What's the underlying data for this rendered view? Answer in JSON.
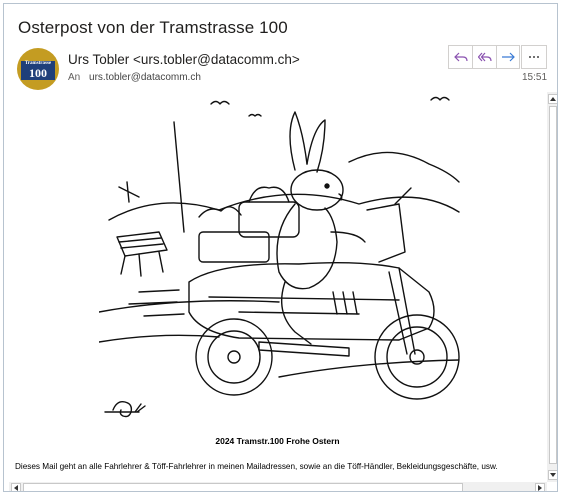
{
  "email": {
    "subject": "Osterpost von der Tramstrasse 100",
    "sender": "Urs Tobler <urs.tobler@datacomm.ch>",
    "to_label": "An",
    "to_address": "urs.tobler@datacomm.ch",
    "time": "15:51",
    "avatar": {
      "line1": "Tramstrasse",
      "line2": "100",
      "color": "#c49c22"
    }
  },
  "actions": {
    "reply_icon": "reply-icon",
    "reply_all_icon": "reply-all-icon",
    "forward_icon": "forward-icon",
    "more_icon": "more-icon",
    "accent": "#8a52b0"
  },
  "body": {
    "caption": "2024 Tramstr.100 Frohe  Ostern",
    "text": "Dieses Mail geht an alle Fahrlehrer & Töff-Fahrlehrer in meinen Mailadressen, sowie an die Töff-Händler, Bekleidungsgeschäfte, usw."
  }
}
